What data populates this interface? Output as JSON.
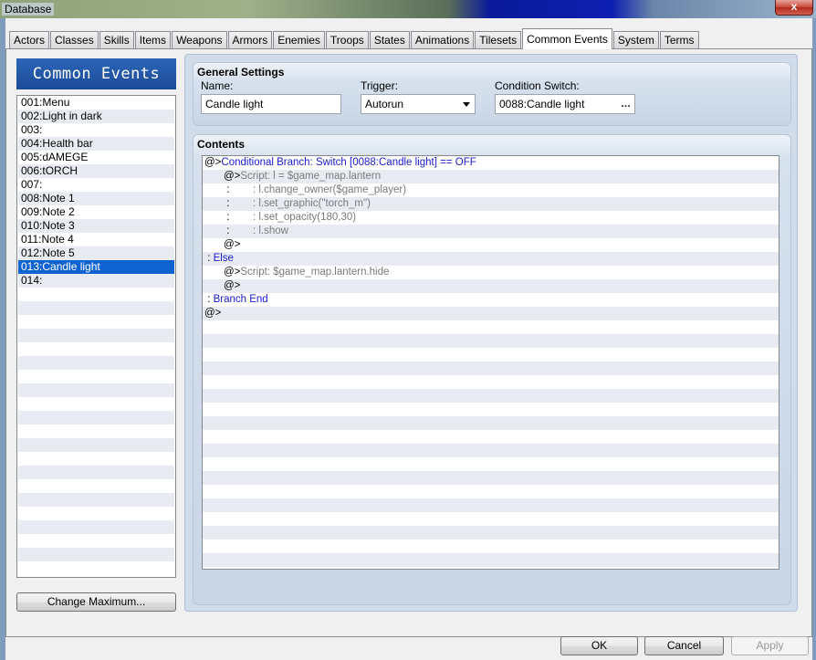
{
  "window": {
    "title": "Database",
    "close_label": "x"
  },
  "tabs": [
    {
      "label": "Actors"
    },
    {
      "label": "Classes"
    },
    {
      "label": "Skills"
    },
    {
      "label": "Items"
    },
    {
      "label": "Weapons"
    },
    {
      "label": "Armors"
    },
    {
      "label": "Enemies"
    },
    {
      "label": "Troops"
    },
    {
      "label": "States"
    },
    {
      "label": "Animations"
    },
    {
      "label": "Tilesets"
    },
    {
      "label": "Common Events",
      "active": true
    },
    {
      "label": "System"
    },
    {
      "label": "Terms"
    }
  ],
  "left_panel": {
    "header": "Common Events",
    "items": [
      "001:Menu",
      "002:Light in dark",
      "003:",
      "004:Health bar",
      "005:dAMEGE",
      "006:tORCH",
      "007:",
      "008:Note 1",
      "009:Note 2",
      "010:Note 3",
      "011:Note 4",
      "012:Note 5",
      "013:Candle light",
      "014:"
    ],
    "selected_index": 12,
    "change_maximum_label": "Change Maximum..."
  },
  "general_settings": {
    "title": "General Settings",
    "name_label": "Name:",
    "name_value": "Candle light",
    "trigger_label": "Trigger:",
    "trigger_value": "Autorun",
    "condition_label": "Condition Switch:",
    "condition_value": "0088:Candle light",
    "condition_button": "…"
  },
  "contents": {
    "title": "Contents",
    "lines": [
      {
        "prefix": "@>",
        "text": "Conditional Branch: Switch [0088:Candle light] == OFF",
        "style": "blue",
        "indent": 0
      },
      {
        "prefix": "@>",
        "text": "Script: l = $game_map.lantern",
        "style": "gray",
        "indent": 1
      },
      {
        "prefix": " :",
        "text": "        : l.change_owner($game_player)",
        "style": "gray",
        "indent": 1
      },
      {
        "prefix": " :",
        "text": "        : l.set_graphic(\"torch_m\")",
        "style": "gray",
        "indent": 1
      },
      {
        "prefix": " :",
        "text": "        : l.set_opacity(180,30)",
        "style": "gray",
        "indent": 1
      },
      {
        "prefix": " :",
        "text": "        : l.show",
        "style": "gray",
        "indent": 1
      },
      {
        "prefix": "@>",
        "text": "",
        "style": "black",
        "indent": 1
      },
      {
        "prefix": " :",
        "text": " Else",
        "style": "blue",
        "indent": 0
      },
      {
        "prefix": "@>",
        "text": "Script: $game_map.lantern.hide",
        "style": "gray",
        "indent": 1
      },
      {
        "prefix": "@>",
        "text": "",
        "style": "black",
        "indent": 1
      },
      {
        "prefix": " :",
        "text": " Branch End",
        "style": "blue",
        "indent": 0
      },
      {
        "prefix": "@>",
        "text": "",
        "style": "black",
        "indent": 0
      }
    ]
  },
  "buttons": {
    "ok": "OK",
    "cancel": "Cancel",
    "apply": "Apply"
  }
}
